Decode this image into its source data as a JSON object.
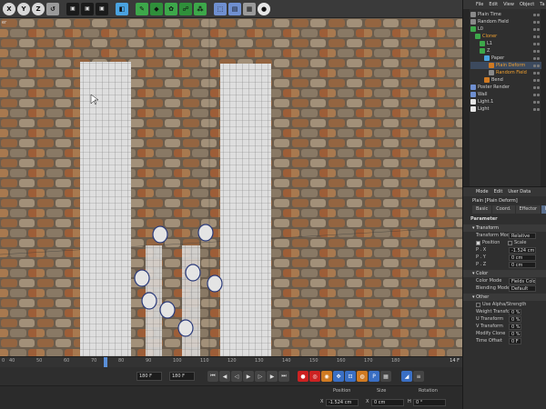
{
  "toolbar": {
    "buttons": [
      "X",
      "Y",
      "Z"
    ],
    "icons": [
      "undo-icon",
      "render-view-icon",
      "render-icon",
      "render-settings-icon",
      "cube-icon",
      "spline-icon",
      "nurbs-icon",
      "array-icon",
      "deformer-icon",
      "scene-icon",
      "camera-icon",
      "floor-icon",
      "light-icon"
    ]
  },
  "viewport": {
    "label": "er"
  },
  "timeline": {
    "ticks": [
      "0",
      "40",
      "50",
      "60",
      "70",
      "80",
      "90",
      "100",
      "110",
      "120",
      "130",
      "140",
      "150",
      "160",
      "170",
      "180"
    ],
    "end_label": "14 F"
  },
  "transport": {
    "start_frame": "180 F",
    "end_frame": "180 F"
  },
  "coords": {
    "position_label": "Position",
    "size_label": "Size",
    "rotation_label": "Rotation",
    "x_label": "X",
    "position_x": "-1.524 cm",
    "size_x": "0 cm",
    "rotation_h": "0 °",
    "h_label": "H"
  },
  "objects": {
    "menu": [
      "File",
      "Edit",
      "View",
      "Object",
      "Ta"
    ],
    "items": [
      {
        "name": "Plain Time",
        "color": "#8a8a8a",
        "indent": 0
      },
      {
        "name": "Random Field",
        "color": "#8a8a8a",
        "indent": 0
      },
      {
        "name": "L0",
        "color": "#3da84a",
        "indent": 0
      },
      {
        "name": "Cloner",
        "color": "#3da84a",
        "indent": 1,
        "orange": true
      },
      {
        "name": "L1",
        "color": "#3da84a",
        "indent": 2
      },
      {
        "name": "Z",
        "color": "#3da84a",
        "indent": 2
      },
      {
        "name": "Paper",
        "color": "#4aa3e0",
        "indent": 3
      },
      {
        "name": "Plain Deform",
        "color": "#d07a22",
        "indent": 4,
        "orange": true,
        "selected": true
      },
      {
        "name": "Random Field",
        "color": "#8a8a8a",
        "indent": 4,
        "orange": true
      },
      {
        "name": "Bend",
        "color": "#d07a22",
        "indent": 3
      },
      {
        "name": "Poster Render",
        "color": "#6f8fd0",
        "indent": 0
      },
      {
        "name": "Wall",
        "color": "#6f8fd0",
        "indent": 0
      },
      {
        "name": "Light.1",
        "color": "#e6e6e6",
        "indent": 0
      },
      {
        "name": "Light",
        "color": "#e6e6e6",
        "indent": 0
      }
    ]
  },
  "attributes": {
    "menu": [
      "Mode",
      "Edit",
      "User Data"
    ],
    "title": "Plain [Plain Deform]",
    "tabs": [
      "Basic",
      "Coord.",
      "Effector"
    ],
    "active_tab": 0,
    "parameter_label": "Parameter",
    "transform": {
      "section_label": "Transform",
      "mode_label": "Transform Mode",
      "mode_value": "Relative",
      "position_label": "Position",
      "scale_label": "Scale",
      "px_label": "P . X",
      "px": "-1.524 cm",
      "py_label": "P . Y",
      "py": "0 cm",
      "pz_label": "P . Z",
      "pz": "0 cm"
    },
    "color": {
      "section_label": "Color",
      "mode_label": "Color Mode",
      "mode_value": "Fields Color",
      "blending_label": "Blending Mode",
      "blending_value": "Default"
    },
    "other": {
      "section_label": "Other",
      "rows": [
        {
          "label": "Use Alpha/Strength",
          "value": ""
        },
        {
          "label": "Weight Transform",
          "value": "0 %"
        },
        {
          "label": "U Transform",
          "value": "0 %"
        },
        {
          "label": "V Transform",
          "value": "0 %"
        },
        {
          "label": "Modify Clone",
          "value": "0 %"
        },
        {
          "label": "Time Offset",
          "value": "0 F"
        }
      ]
    }
  },
  "colors": {
    "accent": "#3a6fc4",
    "selected_row": "#3c4a5e",
    "orange": "#f0a030"
  }
}
